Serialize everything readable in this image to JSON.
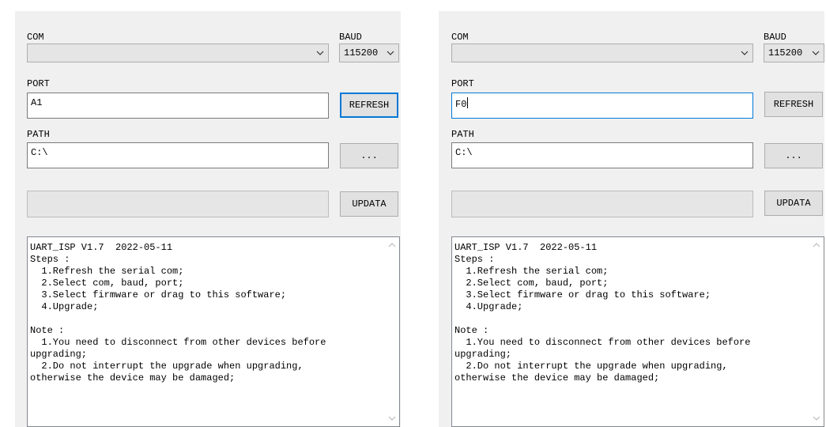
{
  "labels": {
    "com": "COM",
    "baud": "BAUD",
    "port": "PORT",
    "path": "PATH"
  },
  "buttons": {
    "refresh": "REFRESH",
    "browse": "...",
    "update": "UPDATA"
  },
  "icons": {
    "dropdown": "chevron-down-icon",
    "scroll_up": "scroll-up-arrow-icon",
    "scroll_down": "scroll-down-arrow-icon"
  },
  "colors": {
    "focus_border": "#0078d7",
    "panel_bg": "#f0f0f0"
  },
  "log_text": "UART_ISP V1.7  2022-05-11\nSteps :\n  1.Refresh the serial com;\n  2.Select com, baud, port;\n  3.Select firmware or drag to this software;\n  4.Upgrade;\n\nNote :\n  1.You need to disconnect from other devices before\nupgrading;\n  2.Do not interrupt the upgrade when upgrading,\notherwise the device may be damaged;",
  "windows": [
    {
      "com_value": "",
      "baud_value": "115200",
      "port_value": "A1",
      "path_value": "C:\\",
      "progress": 0,
      "focused": "refresh-button"
    },
    {
      "com_value": "",
      "baud_value": "115200",
      "port_value": "F0",
      "path_value": "C:\\",
      "progress": 0,
      "focused": "port-input"
    }
  ]
}
